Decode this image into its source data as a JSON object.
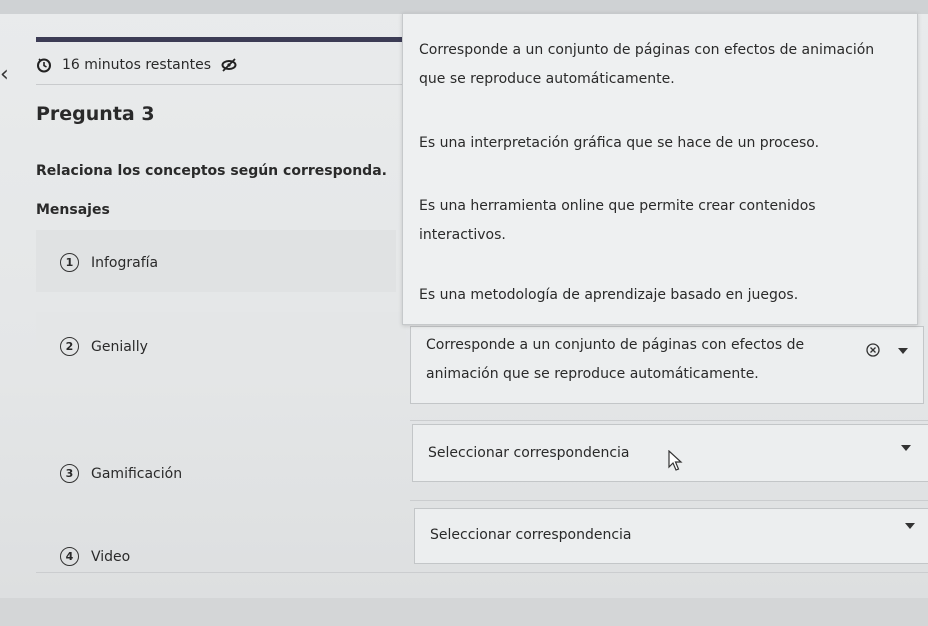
{
  "timer": {
    "text": "16 minutos restantes",
    "clock_icon": "clock-icon",
    "hide_icon": "eye-off-icon"
  },
  "question": {
    "title": "Pregunta 3",
    "instructions": "Relaciona los conceptos según corresponda.",
    "column_header": "Mensajes"
  },
  "items": [
    {
      "number": "1",
      "label": "Infografía"
    },
    {
      "number": "2",
      "label": "Genially"
    },
    {
      "number": "3",
      "label": "Gamificación"
    },
    {
      "number": "4",
      "label": "Video"
    }
  ],
  "dropdown_options": [
    "Corresponde a un conjunto de páginas con efectos de animación que se reproduce automáticamente.",
    "Es una interpretación gráfica que se hace de un proceso.",
    "Es una herramienta online que permite crear contenidos interactivos.",
    "Es una metodología de aprendizaje basado en juegos."
  ],
  "selects": [
    {
      "value": "Corresponde a un conjunto de páginas con efectos de animación que se reproduce automáticamente."
    },
    {
      "value": "Seleccionar correspondencia"
    },
    {
      "value": "Seleccionar correspondencia"
    }
  ],
  "colors": {
    "progress": "#3c3c55",
    "background": "#e6e8e9"
  }
}
